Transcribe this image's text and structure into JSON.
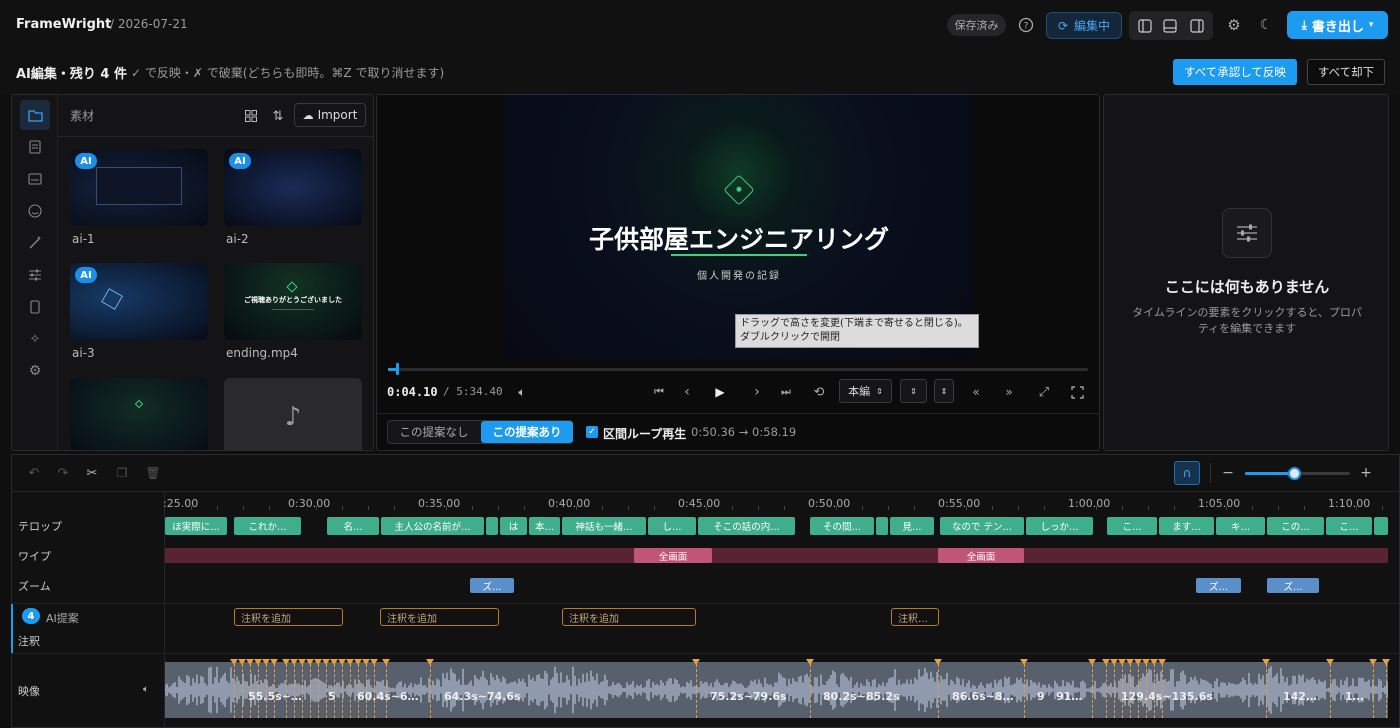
{
  "app": {
    "name": "FrameWright",
    "date": "/ 2026-07-21"
  },
  "header": {
    "saved_badge": "保存済み",
    "editing_label": "編集中",
    "export_label": "書き出し"
  },
  "ai_bar": {
    "title": "AI編集・残り 4 件",
    "hint": "✓ で反映・✗ で破棄(どちらも即時。⌘Z で取り消せます)",
    "approve_all": "すべて承認して反映",
    "reject_all": "すべて却下"
  },
  "media": {
    "title": "素材",
    "import_label": "Import",
    "items": [
      {
        "name": "ai-1",
        "badge": "AI"
      },
      {
        "name": "ai-2",
        "badge": "AI"
      },
      {
        "name": "ai-3",
        "badge": "AI"
      },
      {
        "name": "ending.mp4",
        "badge": ""
      }
    ],
    "ending_thumb_text": "ご視聴ありがとうございました"
  },
  "preview": {
    "title": "子供部屋エンジニアリング",
    "subtitle": "個人開発の記録",
    "tooltip": "ドラッグで高さを変更(下端まで寄せると閉じる)。ダブルクリックで開閉",
    "time_current": "0:04.10",
    "time_total": "/ 5:34.40",
    "quality": "本編",
    "progress": 0.012
  },
  "compare": {
    "without": "この提案なし",
    "with": "この提案あり",
    "loop_label": "区間ループ再生",
    "range": "0:50.36 → 0:58.19"
  },
  "properties": {
    "empty_title": "ここには何もありません",
    "empty_desc": "タイムラインの要素をクリックすると、プロパティを編集できます"
  },
  "timeline": {
    "ticks": [
      ":25.00",
      "0:30.00",
      "0:35.00",
      "0:40.00",
      "0:45.00",
      "0:50.00",
      "0:55.00",
      "1:00.00",
      "1:05.00",
      "1:10.00"
    ],
    "tracks": {
      "telop": "テロップ",
      "wipe": "ワイプ",
      "zoom": "ズーム",
      "ai": "AI提案",
      "ai_count": "4",
      "annotation": "注釈",
      "video": "映像"
    },
    "telop_clips": [
      "ほ実際に…",
      "これか…",
      "名…",
      "主人公の名前が…",
      "は",
      "本…",
      "神話も一緒…",
      "し…",
      "そこの話の内…",
      "その間…",
      "見…",
      "なので テン…",
      "しっか…",
      "こ…",
      "ます…",
      "キ…",
      "この…",
      "こ…"
    ],
    "wipe_clips": [
      "全画面",
      "全画面"
    ],
    "zoom_clips": [
      "ズ…",
      "ズ…",
      "ズ…"
    ],
    "notes": [
      "注釈を追加",
      "注釈を追加",
      "注釈を追加",
      "注釈…"
    ],
    "video_clips": [
      "55.5s~…",
      "5",
      "60.4s~6…",
      "64.3s~74.6s",
      "75.2s~79.6s",
      "80.2s~85.2s",
      "86.6s~8…",
      "9",
      "91…",
      "129.4s~135.6s",
      "142…",
      "1…"
    ]
  },
  "colors": {
    "accent": "#1d9bf0",
    "telop": "#3fae8c",
    "wipe": "#c05578",
    "zoom": "#5b8fc9",
    "marker": "#e8a23a"
  }
}
